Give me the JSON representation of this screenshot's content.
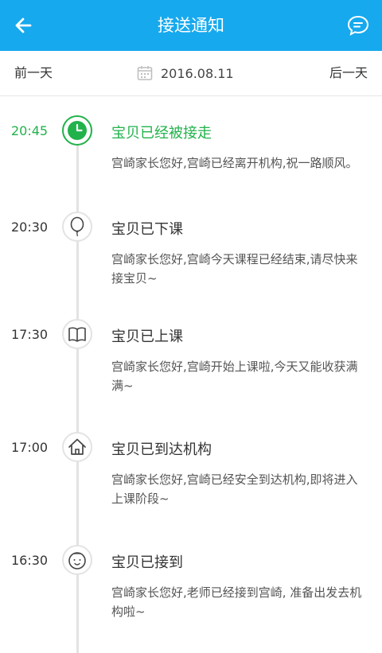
{
  "header": {
    "title": "接送通知",
    "back_icon": "arrow-left-icon",
    "message_icon": "chat-bubble-icon",
    "color": "#16a9ee"
  },
  "date_nav": {
    "prev": "前一天",
    "next": "后一天",
    "date": "2016.08.11",
    "calendar_icon": "calendar-icon"
  },
  "timeline": {
    "active_color": "#22b24b",
    "items": [
      {
        "time": "20:45",
        "title": "宝贝已经被接走",
        "desc": "宫崎家长您好,宫崎已经离开机构,祝一路顺风。",
        "icon": "clock-icon"
      },
      {
        "time": "20:30",
        "title": "宝贝已下课",
        "desc": "宫崎家长您好,宫崎今天课程已经结束,请尽快来接宝贝~",
        "icon": "balloon-icon"
      },
      {
        "time": "17:30",
        "title": "宝贝已上课",
        "desc": "宫崎家长您好,宫崎开始上课啦,今天又能收获满满~",
        "icon": "book-icon"
      },
      {
        "time": "17:00",
        "title": "宝贝已到达机构",
        "desc": "宫崎家长您好,宫崎已经安全到达机构,即将进入上课阶段~",
        "icon": "house-icon"
      },
      {
        "time": "16:30",
        "title": "宝贝已接到",
        "desc": "宫崎家长您好,老师已经接到宫崎, 准备出发去机构啦~",
        "icon": "baby-face-icon"
      }
    ]
  }
}
